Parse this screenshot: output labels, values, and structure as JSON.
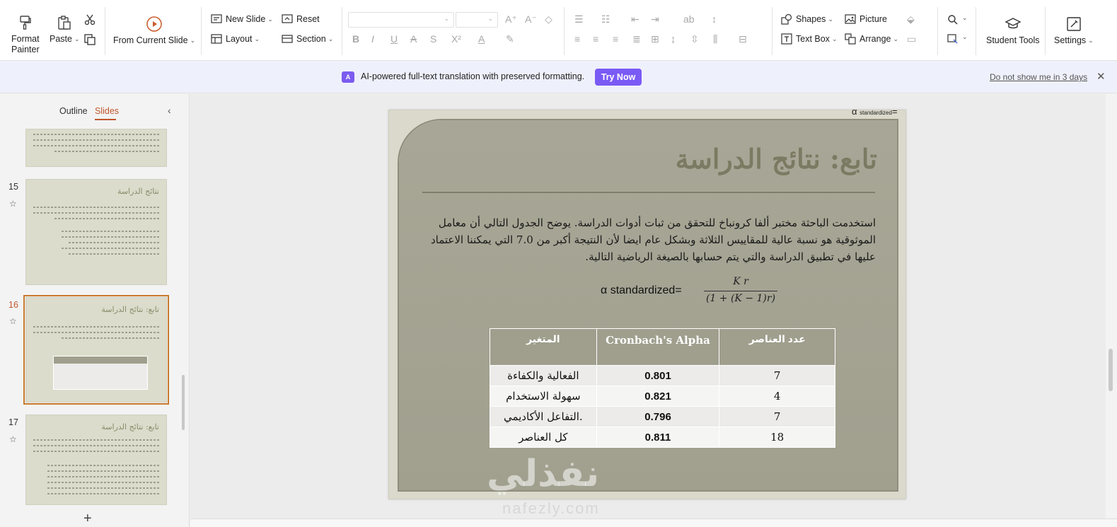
{
  "ribbon": {
    "format_painter": "Format\nPainter",
    "paste": "Paste",
    "from_current_slide": "From Current Slide",
    "new_slide": "New  Slide",
    "reset": "Reset",
    "layout": "Layout",
    "section": "Section",
    "shapes": "Shapes",
    "picture": "Picture",
    "text_box": "Text Box",
    "arrange": "Arrange",
    "student_tools": "Student Tools",
    "settings": "Settings"
  },
  "banner": {
    "badge": "A",
    "text": "AI-powered full-text translation with preserved formatting.",
    "try_now": "Try Now",
    "dismiss": "Do not show me in 3 days"
  },
  "panel": {
    "tab_outline": "Outline",
    "tab_slides": "Slides",
    "slides": [
      {
        "num": "15",
        "title": "نتائج الدراسة"
      },
      {
        "num": "16",
        "title": "تابع: نتائج الدراسة"
      },
      {
        "num": "17",
        "title": "تابع: نتائج الدراسة"
      }
    ]
  },
  "slide": {
    "alpha_note": "α",
    "alpha_sub": "standardized",
    "alpha_eq": "=",
    "title": "تابع: نتائج الدراسة",
    "body": "استخدمت الباحثة مختبر ألفا كرونباخ للتحقق من ثبات أدوات الدراسة. يوضح الجدول التالي أن معامل الموثوقية هو نسبة عالية للمقاييس الثلاثة وبشكل عام ايضا لأن النتيجة أكبر من 7.0 التي يمكننا الاعتماد عليها في تطبيق الدراسة والتي يتم حسابها بالصيغة الرياضية التالية.",
    "formula_left": "α standardized=",
    "formula_num": "K r",
    "formula_den": "(1 + (K − 1)r)",
    "table": {
      "headers": [
        "المتغير",
        "Cronbach's Alpha",
        "عدد العناصر"
      ],
      "rows": [
        [
          "الفعالية والكفاءة",
          "0.801",
          "7"
        ],
        [
          "سهولة الاستخدام",
          "0.821",
          "4"
        ],
        [
          "التفاعل الأكاديمي.",
          "0.796",
          "7"
        ],
        [
          "كل العناصر",
          "0.811",
          "18"
        ]
      ]
    }
  },
  "watermark": {
    "arabic": "نفذلي",
    "latin": "nafezly.com"
  }
}
